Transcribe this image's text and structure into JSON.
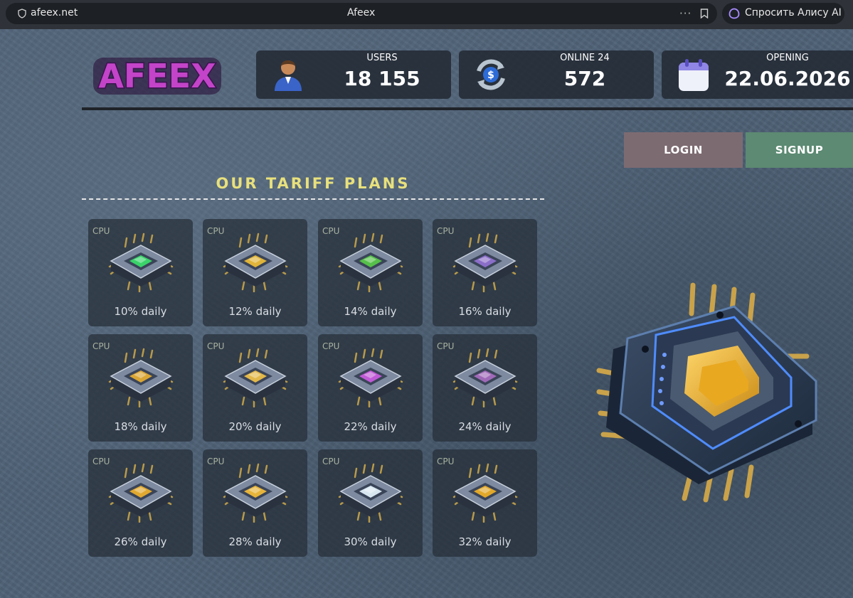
{
  "browser": {
    "url": "afeex.net",
    "title": "Afeex",
    "more": "···",
    "alice_label": "Спросить Алису AI"
  },
  "header": {
    "logo_text": "AFEEX",
    "stats": [
      {
        "label": "USERS",
        "value": "18 155",
        "icon": "user-icon"
      },
      {
        "label": "ONLINE 24",
        "value": "572",
        "icon": "exchange-icon"
      },
      {
        "label": "OPENING",
        "value": "22.06.2026",
        "icon": "calendar-icon"
      }
    ]
  },
  "auth": {
    "login": "LOGIN",
    "signup": "SIGNUP"
  },
  "plans_section": {
    "title": "OUR TARIFF PLANS",
    "plans": [
      {
        "label": "CPU",
        "rate": "10% daily",
        "color": "#3ad36a"
      },
      {
        "label": "CPU",
        "rate": "12% daily",
        "color": "#e0b43a"
      },
      {
        "label": "CPU",
        "rate": "14% daily",
        "color": "#56c04a"
      },
      {
        "label": "CPU",
        "rate": "16% daily",
        "color": "#8a6ec8"
      },
      {
        "label": "CPU",
        "rate": "18% daily",
        "color": "#d9a534"
      },
      {
        "label": "CPU",
        "rate": "20% daily",
        "color": "#e3b84a"
      },
      {
        "label": "CPU",
        "rate": "22% daily",
        "color": "#c05ad6"
      },
      {
        "label": "CPU",
        "rate": "24% daily",
        "color": "#a06ab8"
      },
      {
        "label": "CPU",
        "rate": "26% daily",
        "color": "#e0a830"
      },
      {
        "label": "CPU",
        "rate": "28% daily",
        "color": "#e6b43a"
      },
      {
        "label": "CPU",
        "rate": "30% daily",
        "color": "#d8e6f0"
      },
      {
        "label": "CPU",
        "rate": "32% daily",
        "color": "#e2a82a"
      }
    ]
  },
  "colors": {
    "accent_title": "#e8e07c",
    "login_bg": "#7d6b72",
    "signup_bg": "#5c8a72"
  }
}
